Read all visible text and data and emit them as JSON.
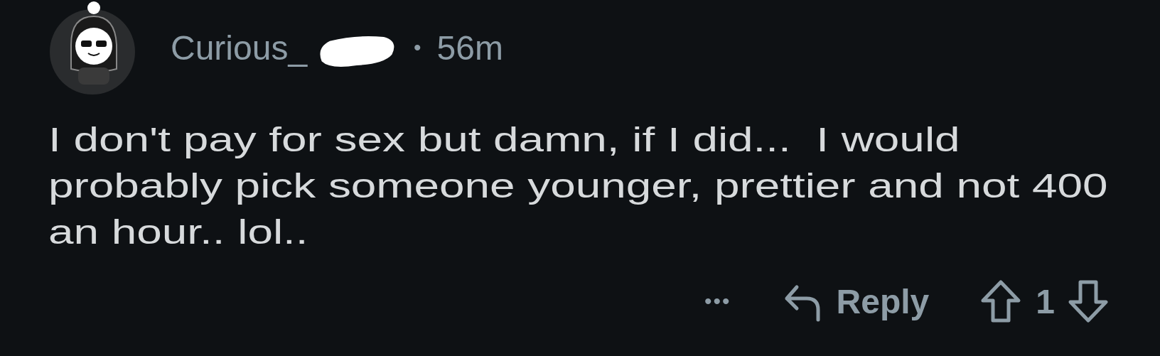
{
  "comment": {
    "username": "Curious_",
    "username_redacted": true,
    "separator": "•",
    "time": "56m",
    "body": "I don't pay for sex but damn, if I did...  I would probably pick someone younger, prettier and not 400 an hour.. lol..",
    "actions": {
      "more": "•••",
      "reply": "Reply",
      "score": "1"
    }
  }
}
